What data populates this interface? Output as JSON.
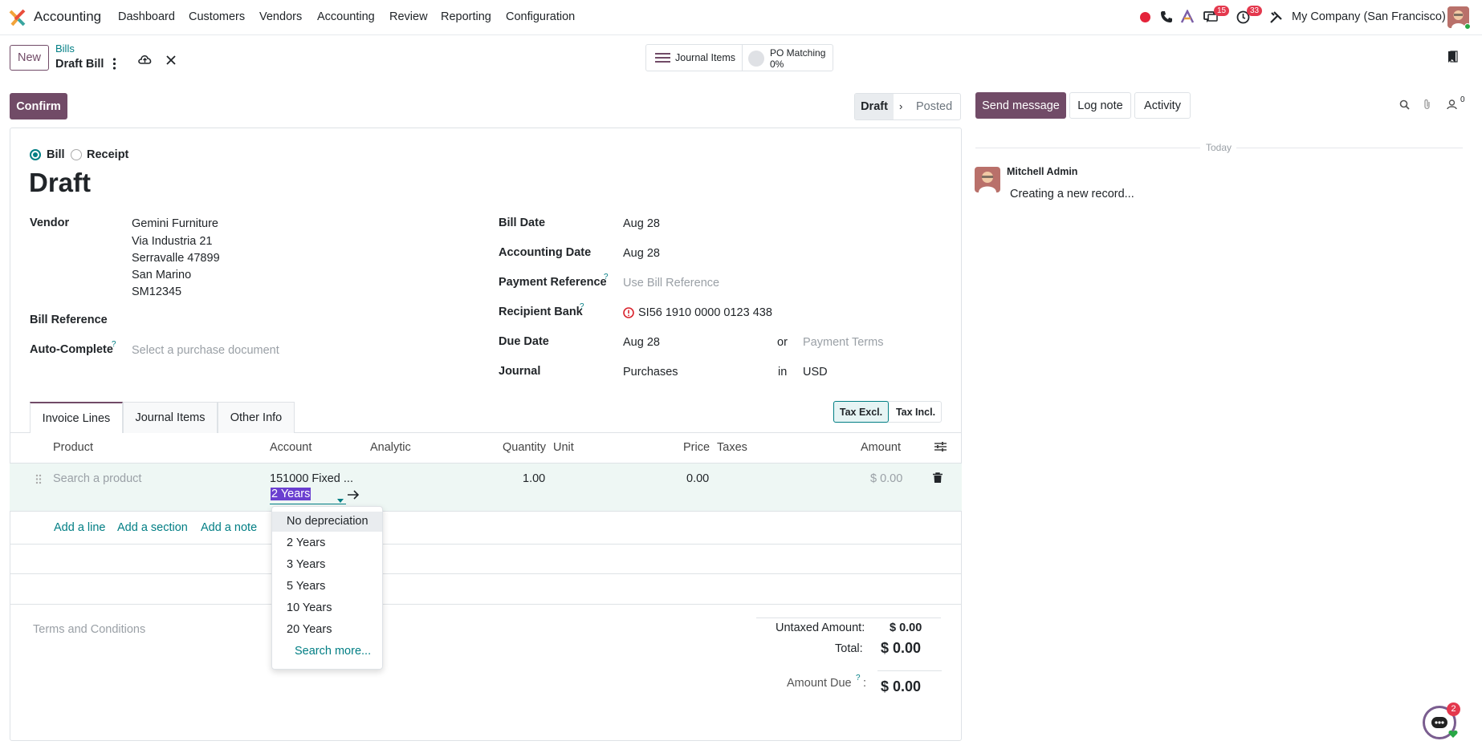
{
  "nav": {
    "app": "Accounting",
    "menu": [
      "Dashboard",
      "Customers",
      "Vendors",
      "Accounting",
      "Review",
      "Reporting",
      "Configuration"
    ],
    "messages_badge": "15",
    "activities_badge": "33",
    "company": "My Company (San Francisco)"
  },
  "control": {
    "new_label": "New",
    "breadcrumb_parent": "Bills",
    "breadcrumb_current": "Draft Bill",
    "journal_items": "Journal Items",
    "po_matching": "PO Matching",
    "po_matching_pct": "0%",
    "confirm": "Confirm",
    "status": [
      "Draft",
      "Posted"
    ]
  },
  "chatter": {
    "send_message": "Send message",
    "log_note": "Log note",
    "activity": "Activity",
    "followers_count": "0",
    "date_separator": "Today",
    "author": "Mitchell Admin",
    "message": "Creating a new record..."
  },
  "form": {
    "type_bill": "Bill",
    "type_receipt": "Receipt",
    "title": "Draft",
    "vendor_label": "Vendor",
    "vendor_lines": [
      "Gemini Furniture",
      "Via Industria 21",
      "Serravalle 47899",
      "San Marino",
      "SM12345"
    ],
    "bill_reference_label": "Bill Reference",
    "auto_complete_label": "Auto-Complete",
    "auto_complete_placeholder": "Select a purchase document",
    "bill_date_label": "Bill Date",
    "bill_date": "Aug 28",
    "accounting_date_label": "Accounting Date",
    "accounting_date": "Aug 28",
    "payment_reference_label": "Payment Reference",
    "payment_reference_placeholder": "Use Bill Reference",
    "recipient_bank_label": "Recipient Bank",
    "recipient_bank": "SI56 1910 0000 0123 438",
    "due_date_label": "Due Date",
    "due_date": "Aug 28",
    "or": "or",
    "payment_terms_placeholder": "Payment Terms",
    "journal_label": "Journal",
    "journal": "Purchases",
    "in": "in",
    "currency": "USD"
  },
  "tabs": [
    "Invoice Lines",
    "Journal Items",
    "Other Info"
  ],
  "tax_toggle": [
    "Tax Excl.",
    "Tax Incl."
  ],
  "table": {
    "headers": [
      "Product",
      "Account",
      "Analytic",
      "Quantity",
      "Unit",
      "Price",
      "Taxes",
      "Amount"
    ],
    "row": {
      "product_placeholder": "Search a product",
      "account": "151000 Fixed ...",
      "asset_model": "2 Years",
      "quantity": "1.00",
      "price": "0.00",
      "amount": "$ 0.00"
    },
    "add_line": "Add a line",
    "add_section": "Add a section",
    "add_note": "Add a note"
  },
  "dropdown": {
    "items": [
      "No depreciation",
      "2 Years",
      "3 Years",
      "5 Years",
      "10 Years",
      "20 Years"
    ],
    "search_more": "Search more..."
  },
  "totals": {
    "terms_placeholder": "Terms and Conditions",
    "untaxed_label": "Untaxed Amount:",
    "untaxed": "$ 0.00",
    "total_label": "Total:",
    "total": "$ 0.00",
    "amount_due_label": "Amount Due",
    "amount_due": "$ 0.00"
  },
  "livechat_badge": "2",
  "colors": {
    "brand": "#714b67",
    "link": "#017e84",
    "badge": "#e4384d",
    "highlight": "#6a3fd0"
  }
}
